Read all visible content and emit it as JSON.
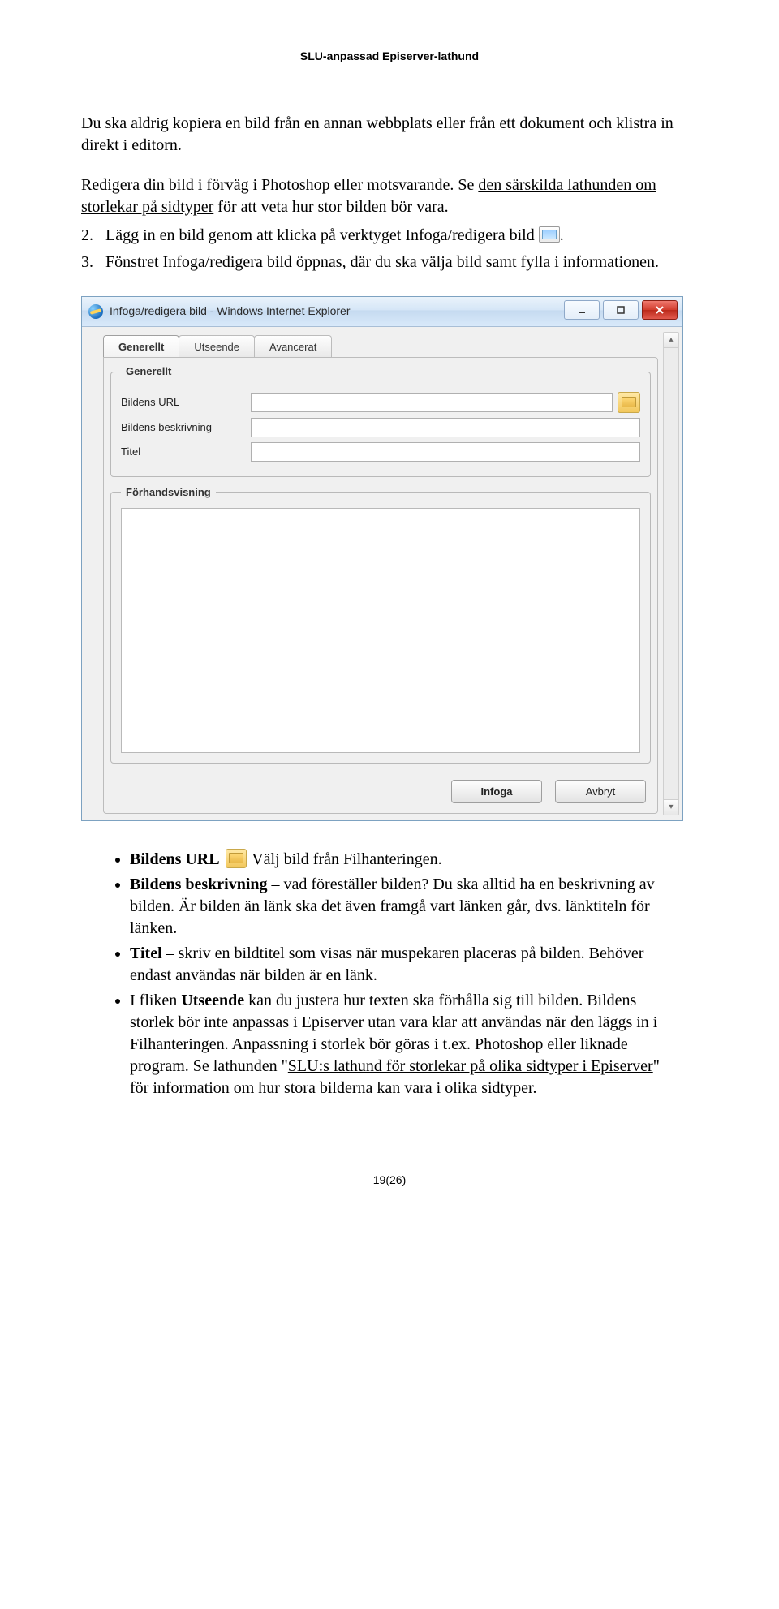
{
  "header": "SLU-anpassad Episerver-lathund",
  "intro": {
    "p1": "Du ska aldrig kopiera en bild från en annan webbplats eller från ett dokument och klistra in direkt i editorn.",
    "p2a": "Redigera din bild i förväg i Photoshop eller motsvarande. Se ",
    "p2link": "den särskilda lathunden om storlekar på sidtyper",
    "p2b": " för att veta hur stor bilden bör vara."
  },
  "steps": {
    "s2a": "Lägg in en bild genom att klicka på verktyget Infoga/redigera bild ",
    "s2b": ".",
    "s3": "Fönstret Infoga/redigera bild öppnas, där du ska välja bild samt fylla i informationen."
  },
  "dialog": {
    "title": "Infoga/redigera bild - Windows Internet Explorer",
    "tabs": [
      "Generellt",
      "Utseende",
      "Avancerat"
    ],
    "selectedTab": "Generellt",
    "legendGeneral": "Generellt",
    "labels": {
      "url": "Bildens URL",
      "desc": "Bildens beskrivning",
      "title": "Titel"
    },
    "values": {
      "url": "",
      "desc": "",
      "title": ""
    },
    "legendPreview": "Förhandsvisning",
    "buttons": {
      "ok": "Infoga",
      "cancel": "Avbryt"
    }
  },
  "bullets": {
    "b1_boldA": "Bildens URL",
    "b1_rest": " Välj bild från Filhanteringen.",
    "b2_bold": "Bildens beskrivning",
    "b2_rest": " – vad föreställer bilden? Du ska alltid ha en beskrivning av bilden. Är bilden än länk ska det även framgå vart länken går, dvs. länktiteln för länken.",
    "b3_bold": "Titel",
    "b3_rest": " – skriv en bildtitel som visas när muspekaren placeras på bilden. Behöver endast användas när bilden är en länk.",
    "b4a": "I fliken ",
    "b4_bold": "Utseende",
    "b4b": " kan du justera hur texten ska förhålla sig till bilden. Bildens storlek bör inte anpassas i Episerver utan vara klar att användas när den läggs in i Filhanteringen. Anpassning i storlek bör göras i t.ex. Photoshop eller liknade program. Se lathunden \"",
    "b4_link": "SLU:s lathund för storlekar på olika sidtyper i Episerver",
    "b4c": "\" för information om hur stora bilderna kan vara i olika sidtyper."
  },
  "footer": "19(26)"
}
